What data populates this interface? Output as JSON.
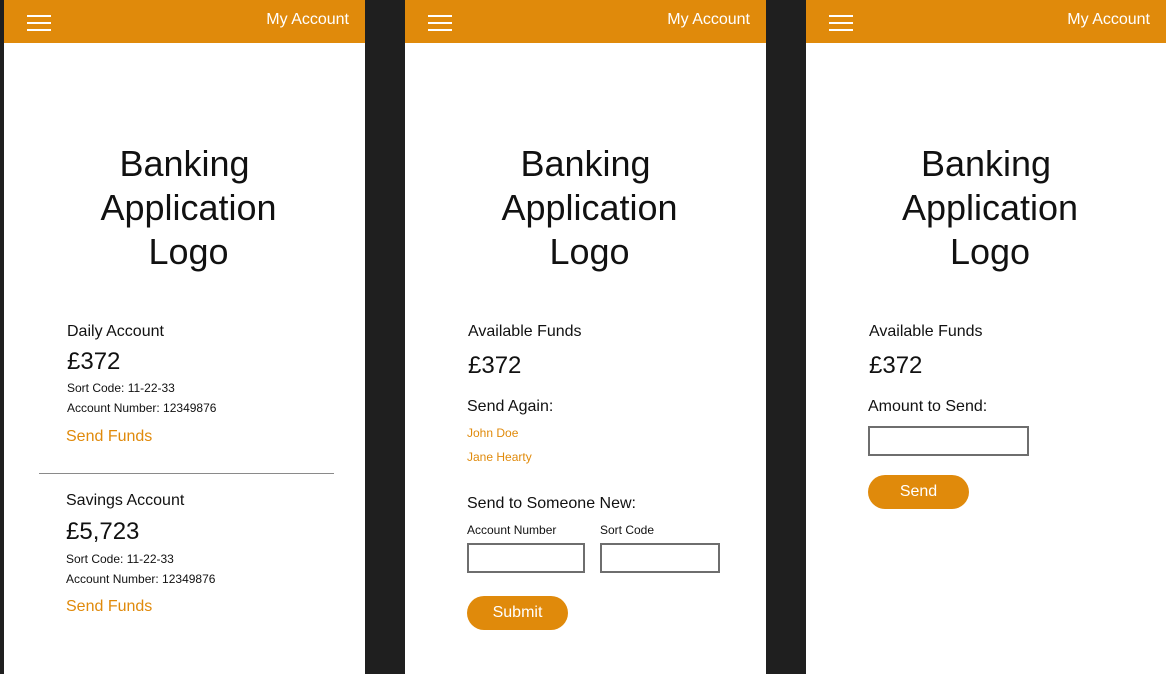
{
  "header": {
    "account_label": "My Account",
    "color": "#e08a0b",
    "menu_icon": "hamburger-menu-icon"
  },
  "logo": {
    "line1": "Banking",
    "line2": "Application",
    "line3": "Logo"
  },
  "screen1": {
    "accounts": [
      {
        "name": "Daily Account",
        "balance": "£372",
        "sort_code": "Sort Code: 11-22-33",
        "account_number": "Account Number: 12349876",
        "action": "Send Funds"
      },
      {
        "name": "Savings Account",
        "balance": "£5,723",
        "sort_code": "Sort Code: 11-22-33",
        "account_number": "Account Number: 12349876",
        "action": "Send Funds"
      }
    ]
  },
  "screen2": {
    "funds_label": "Available Funds",
    "funds_value": "£372",
    "send_again_label": "Send Again:",
    "recent_payees": [
      "John Doe",
      "Jane Hearty"
    ],
    "new_payee_label": "Send to Someone New:",
    "account_number_label": "Account Number",
    "account_number_value": "",
    "sort_code_label": "Sort Code",
    "sort_code_value": "",
    "submit_label": "Submit"
  },
  "screen3": {
    "funds_label": "Available Funds",
    "funds_value": "£372",
    "amount_label": "Amount to Send:",
    "amount_value": "",
    "send_label": "Send"
  }
}
